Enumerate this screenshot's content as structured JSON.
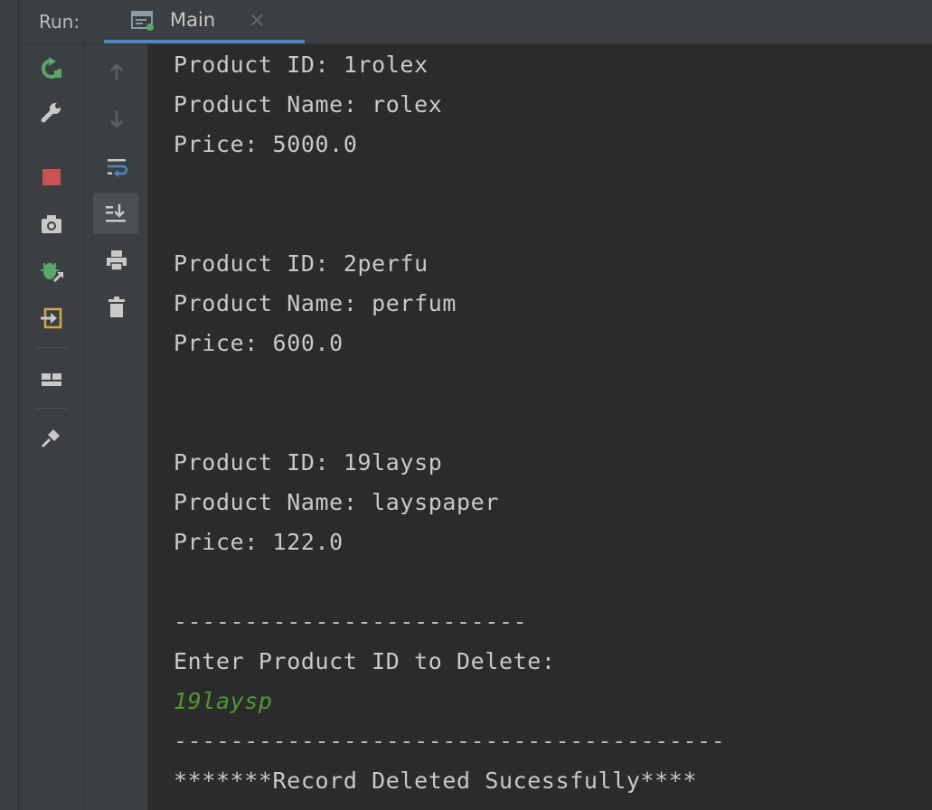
{
  "header": {
    "run_label": "Run:",
    "tab_label": "Main",
    "tab_close": "×"
  },
  "console": {
    "lines": [
      "Product ID: 1rolex",
      "Product Name: rolex",
      "Price: 5000.0",
      "Product ID: 2perfu",
      "Product Name: perfum",
      "Price: 600.0",
      "Product ID: 19laysp",
      "Product Name: layspaper",
      "Price: 122.0",
      "-------------------------",
      "Enter Product ID to Delete:",
      "19laysp",
      "---------------------------------------",
      "*******Record Deleted Sucessfully****"
    ]
  },
  "colors": {
    "background": "#2b2b2b",
    "panel": "#3c3f41",
    "text": "#c9c9c9",
    "user_input": "#4e9a2f",
    "tab_underline": "#4a88c7",
    "rerun_green": "#59a869",
    "stop_red": "#c75450"
  },
  "icons": {
    "toolbar_left": [
      "rerun-icon",
      "wrench-icon",
      "stop-icon",
      "camera-icon",
      "debug-icon",
      "exit-icon",
      "layout-icon",
      "pin-icon"
    ],
    "toolbar_right": [
      "arrow-up-icon",
      "arrow-down-icon",
      "soft-wrap-icon",
      "scroll-to-end-icon",
      "print-icon",
      "trash-icon"
    ]
  }
}
